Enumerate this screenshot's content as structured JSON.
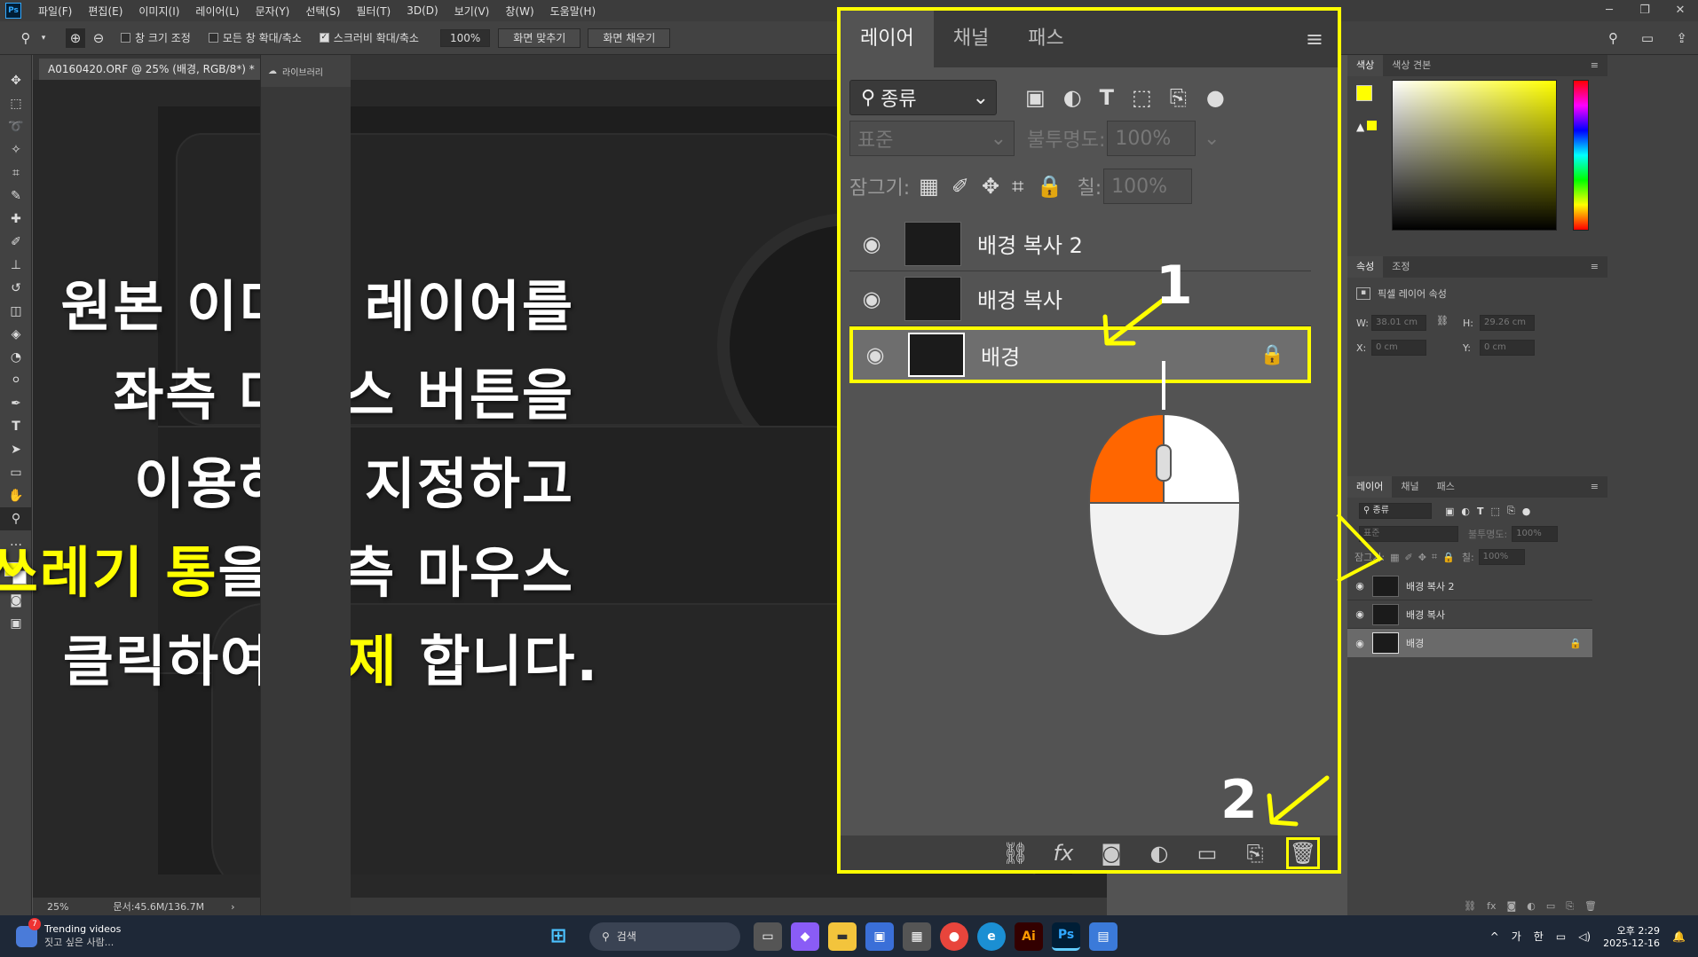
{
  "app": {
    "logo": "Ps"
  },
  "menu": [
    "파일(F)",
    "편집(E)",
    "이미지(I)",
    "레이어(L)",
    "문자(Y)",
    "선택(S)",
    "필터(T)",
    "3D(D)",
    "보기(V)",
    "창(W)",
    "도움말(H)"
  ],
  "options": {
    "resize_window": "창 크기 조정",
    "zoom_all": "모든 창 확대/축소",
    "scrubby_zoom": "스크러비 확대/축소",
    "zoom_value": "100%",
    "fit_screen": "화면 맞추기",
    "fill_screen": "화면 채우기"
  },
  "document": {
    "tab_title": "A0160420.ORF @ 25% (배경, RGB/8*) *",
    "zoom": "25%",
    "doc_size": "문서:45.6M/136.7M"
  },
  "overlay": {
    "line1": "원본 이미지 레이어를",
    "line2": "좌측 마우스 버튼을",
    "line3": "이용하여 지정하고",
    "line4_hl": "쓰레기 통",
    "line4_rest": "을 좌측 마우스",
    "line5_a": "클릭하여 ",
    "line5_hl": "삭제",
    "line5_b": " 합니다.",
    "step1": "1",
    "step2": "2",
    "highlight_color": "#ffff00"
  },
  "zoom_panel": {
    "tabs": [
      "레이어",
      "채널",
      "패스"
    ],
    "filter": "종류",
    "blend_mode": "표준",
    "opacity_label": "불투명도:",
    "opacity_value": "100%",
    "lock_label": "잠그기:",
    "fill_label": "칠:",
    "fill_value": "100%",
    "layers": [
      "배경 복사 2",
      "배경 복사",
      "배경"
    ]
  },
  "right_panels": {
    "color_tabs": [
      "색상",
      "색상 견본"
    ],
    "props_tabs": [
      "속성",
      "조정"
    ],
    "props_title": "픽셀 레이어 속성",
    "w_label": "W:",
    "w_value": "38.01 cm",
    "h_label": "H:",
    "h_value": "29.26 cm",
    "x_label": "X:",
    "x_value": "0 cm",
    "y_label": "Y:",
    "y_value": "0 cm",
    "layers_tabs": [
      "레이어",
      "채널",
      "패스"
    ],
    "filter": "종류",
    "blend_mode": "표준",
    "opacity_label": "불투명도:",
    "opacity_value": "100%",
    "lock_label": "잠그기:",
    "fill_label": "칠:",
    "fill_value": "100%",
    "layers": [
      "배경 복사 2",
      "배경 복사",
      "배경"
    ],
    "library": "라이브러리"
  },
  "taskbar": {
    "widget_title": "Trending videos",
    "widget_sub": "짓고 싶은 사람...",
    "widget_badge": "7",
    "search": "검색",
    "ime1": "가",
    "ime2": "한",
    "time": "오후 2:29",
    "date": "2025-12-16"
  }
}
